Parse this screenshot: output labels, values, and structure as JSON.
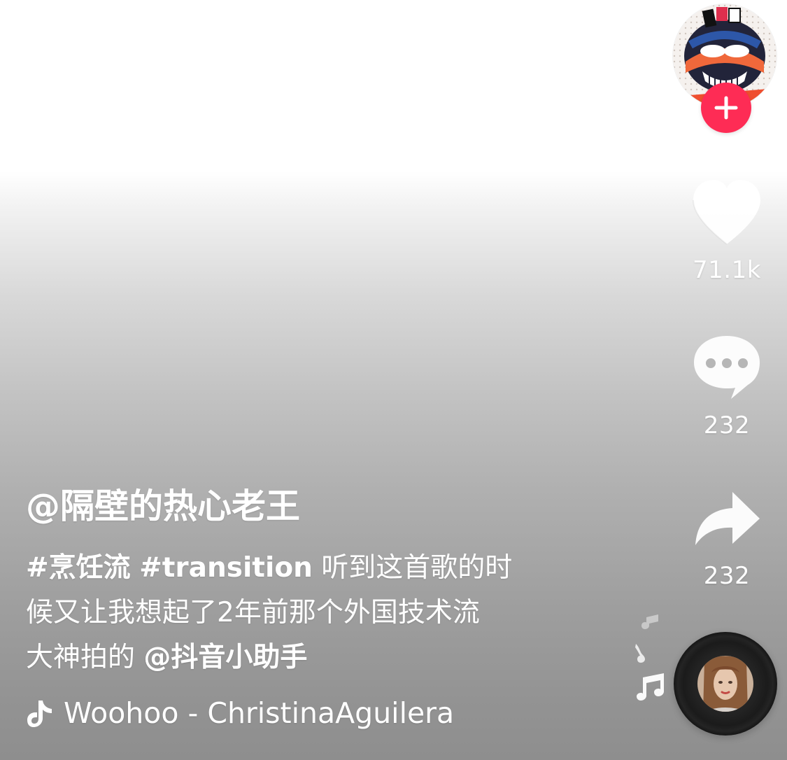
{
  "creator": {
    "avatar_icon": "creator-avatar",
    "follow_icon": "plus-icon",
    "follow_color": "#fe2c55"
  },
  "actions": {
    "like": {
      "icon": "heart-icon",
      "count": "71.1k"
    },
    "comment": {
      "icon": "comment-bubble-icon",
      "count": "232"
    },
    "share": {
      "icon": "share-arrow-icon",
      "count": "232"
    }
  },
  "caption": {
    "username": "@隔壁的热心老王",
    "hashtag_1": "#烹饪流",
    "hashtag_2": "#transition",
    "text_1": "听到这首歌的时",
    "text_2": "候又让我想起了2年前那个外国技术流",
    "text_3": "大神拍的",
    "mention": "@抖音小助手"
  },
  "music": {
    "icon": "tiktok-note-icon",
    "title": "Woohoo - ChristinaAguilera",
    "disc_icon": "music-disc"
  }
}
